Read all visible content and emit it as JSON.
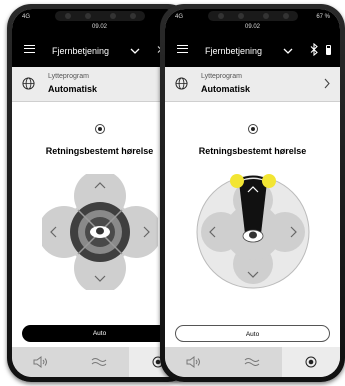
{
  "phones": [
    {
      "status": {
        "signal": "4G",
        "time": "09.02",
        "battery": ""
      },
      "header": {
        "title": "Fjernbetjening"
      },
      "program": {
        "label": "Lytteprogram",
        "value": "Automatisk"
      },
      "section_title": "Retningsbestemt hørelse",
      "auto_button": "Auto",
      "colors": {
        "accent": "#f2e533",
        "dial": "#c9c9c9"
      }
    },
    {
      "status": {
        "signal": "4G",
        "time": "09.02",
        "battery": "67 %"
      },
      "header": {
        "title": "Fjernbetjening"
      },
      "program": {
        "label": "Lytteprogram",
        "value": "Automatisk"
      },
      "section_title": "Retningsbestemt hørelse",
      "auto_button": "Auto",
      "colors": {
        "accent": "#f2e533",
        "dial": "#c9c9c9"
      }
    }
  ],
  "tabs": [
    {
      "icon": "speaker-volume-icon"
    },
    {
      "icon": "noise-wave-icon"
    },
    {
      "icon": "target-mode-icon"
    }
  ]
}
